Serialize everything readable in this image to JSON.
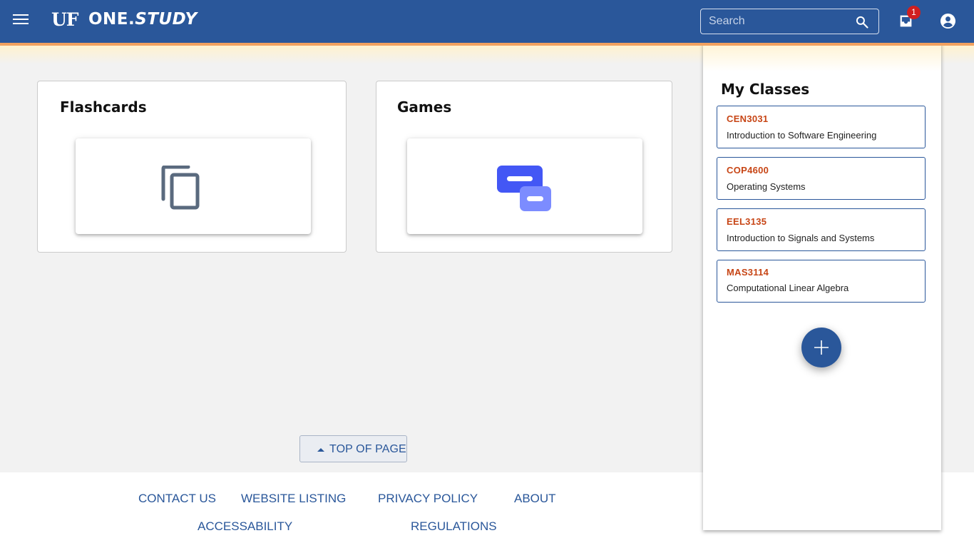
{
  "header": {
    "logo_mark": "UF",
    "logo_text_a": "ONE.",
    "logo_text_b": "STUDY",
    "search_placeholder": "Search",
    "notification_count": "1",
    "colors": {
      "bar": "#2a579a",
      "stripe": "#f2a15f",
      "badge": "#d11f1f"
    },
    "icons": [
      "menu-icon",
      "search-icon",
      "inbox-icon",
      "account-circle-icon"
    ]
  },
  "cards": [
    {
      "title": "Flashcards",
      "icon": "copy-cards-icon"
    },
    {
      "title": "Games",
      "icon": "chat-bubbles-icon"
    }
  ],
  "top_of_page": {
    "label": "TOP OF PAGE"
  },
  "footer": {
    "links": [
      "CONTACT US",
      "WEBSITE LISTING",
      "PRIVACY POLICY",
      "ABOUT",
      "ACCESSABILITY",
      "REGULATIONS"
    ]
  },
  "side_panel": {
    "title": "My Classes",
    "classes": [
      {
        "code": "CEN3031",
        "name": "Introduction to Software Engineering"
      },
      {
        "code": "COP4600",
        "name": "Operating Systems"
      },
      {
        "code": "EEL3135",
        "name": "Introduction to Signals and Systems"
      },
      {
        "code": "MAS3114",
        "name": "Computational Linear Algebra"
      }
    ],
    "add_button_icon": "plus-icon",
    "colors": {
      "code": "#c74515",
      "border": "#2a579a"
    }
  }
}
